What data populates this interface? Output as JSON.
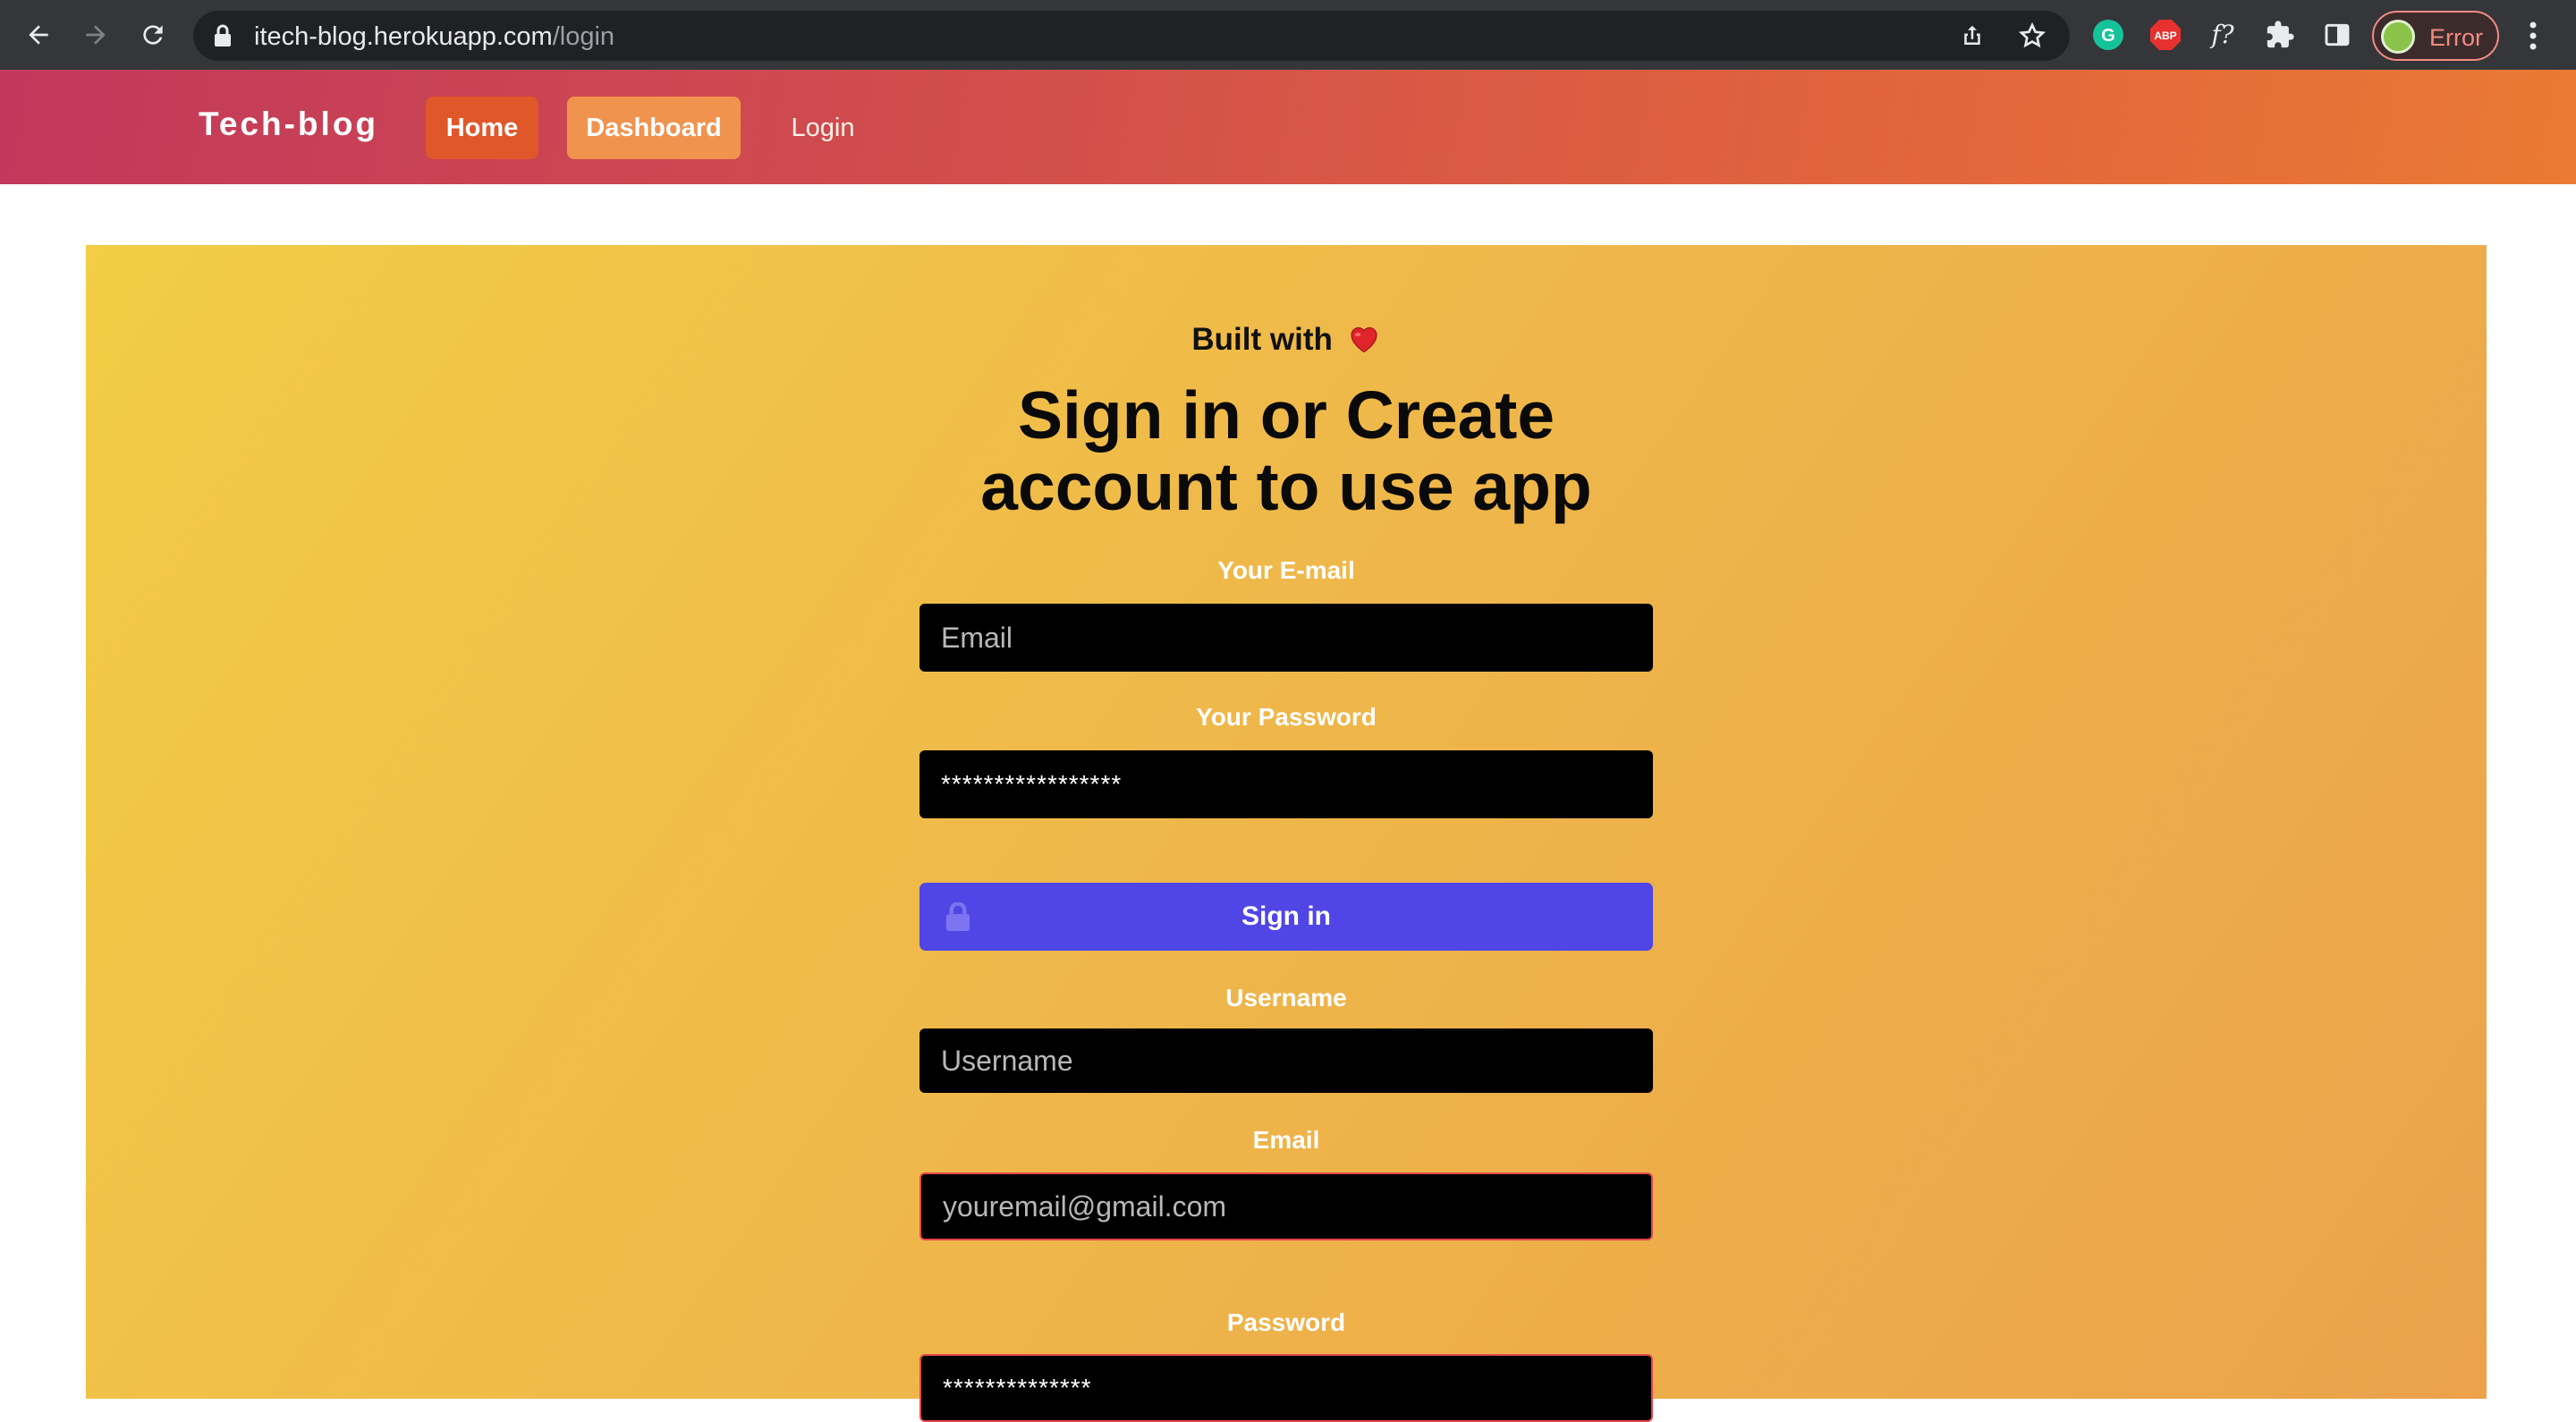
{
  "browser": {
    "url_host": "itech-blog.herokuapp.com",
    "url_path": "/login",
    "profile_status": "Error"
  },
  "header": {
    "brand": "Tech-blog",
    "nav": {
      "home": "Home",
      "dashboard": "Dashboard",
      "login": "Login"
    }
  },
  "login_form": {
    "built_with": "Built with",
    "title_line1": "Sign in or Create",
    "title_line2": "account to use app",
    "email_label": "Your E-mail",
    "email_placeholder": "Email",
    "password_label": "Your Password",
    "password_value": "*****************",
    "signin_button": "Sign in"
  },
  "signup_form": {
    "username_label": "Username",
    "username_placeholder": "Username",
    "email_label": "Email",
    "email_placeholder": "youremail@gmail.com",
    "password_label": "Password",
    "password_value": "**************"
  },
  "colors": {
    "header_gradient_start": "#c2385c",
    "header_gradient_end": "#ea7a34",
    "panel_gradient_start": "#f2cd45",
    "panel_gradient_end": "#eba24b",
    "signin_button": "#4f46e5",
    "input_bg": "#000000"
  }
}
